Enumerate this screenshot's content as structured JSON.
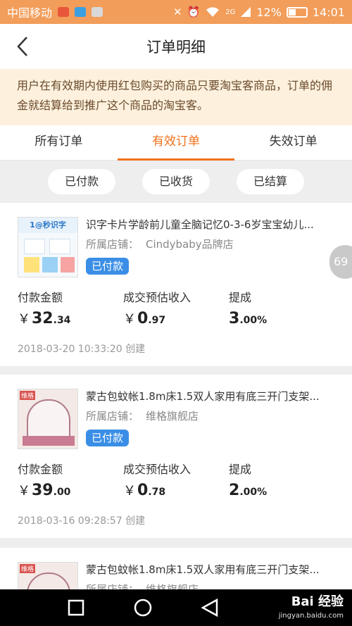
{
  "status_bar": {
    "carrier": "中国移动",
    "signal_label": "2G",
    "battery": "12%",
    "time": "14:01"
  },
  "nav": {
    "title": "订单明细"
  },
  "notice": {
    "text": "用户在有效期内使用红包购买的商品只要淘宝客商品，订单的佣金就结算给到推广这个商品的淘宝客。"
  },
  "tabs": [
    "所有订单",
    "有效订单",
    "失效订单"
  ],
  "filters": [
    "已付款",
    "已收货",
    "已结算"
  ],
  "orders": [
    {
      "title": "识字卡片学龄前儿童全脑记忆0-3-6岁宝宝幼儿...",
      "shop_label": "所属店铺：",
      "shop": "Cindybaby品牌店",
      "status": "已付款",
      "pay_label": "付款金额",
      "pay_int": "32",
      "pay_dec": ".34",
      "income_label": "成交预估收入",
      "income_int": "0",
      "income_dec": ".97",
      "rate_label": "提成",
      "rate_int": "3",
      "rate_dec": ".00%",
      "created": "2018-03-20 10:33:20 创建",
      "thumb_text": "1@秒识字"
    },
    {
      "title": "蒙古包蚊帐1.8m床1.5双人家用有底三开门支架...",
      "shop_label": "所属店铺：",
      "shop": "维格旗舰店",
      "status": "已付款",
      "pay_label": "付款金额",
      "pay_int": "39",
      "pay_dec": ".00",
      "income_label": "成交预估收入",
      "income_int": "0",
      "income_dec": ".78",
      "rate_label": "提成",
      "rate_int": "2",
      "rate_dec": ".00%",
      "created": "2018-03-16 09:28:57 创建",
      "thumb_text": "维格"
    },
    {
      "title": "蒙古包蚊帐1.8m床1.5双人家用有底三开门支架...",
      "shop_label": "所属店铺：",
      "shop": "维格旗舰店",
      "thumb_text": "维格"
    }
  ],
  "currency": "￥",
  "float_badge": "69",
  "watermark": {
    "main": "Bai 经验",
    "sub": "jingyan.baidu.com"
  },
  "colors": {
    "accent": "#f2711c",
    "status_bar": "#f29d5a",
    "badge": "#3a8ee6",
    "notice_bg": "#fdf1de"
  }
}
